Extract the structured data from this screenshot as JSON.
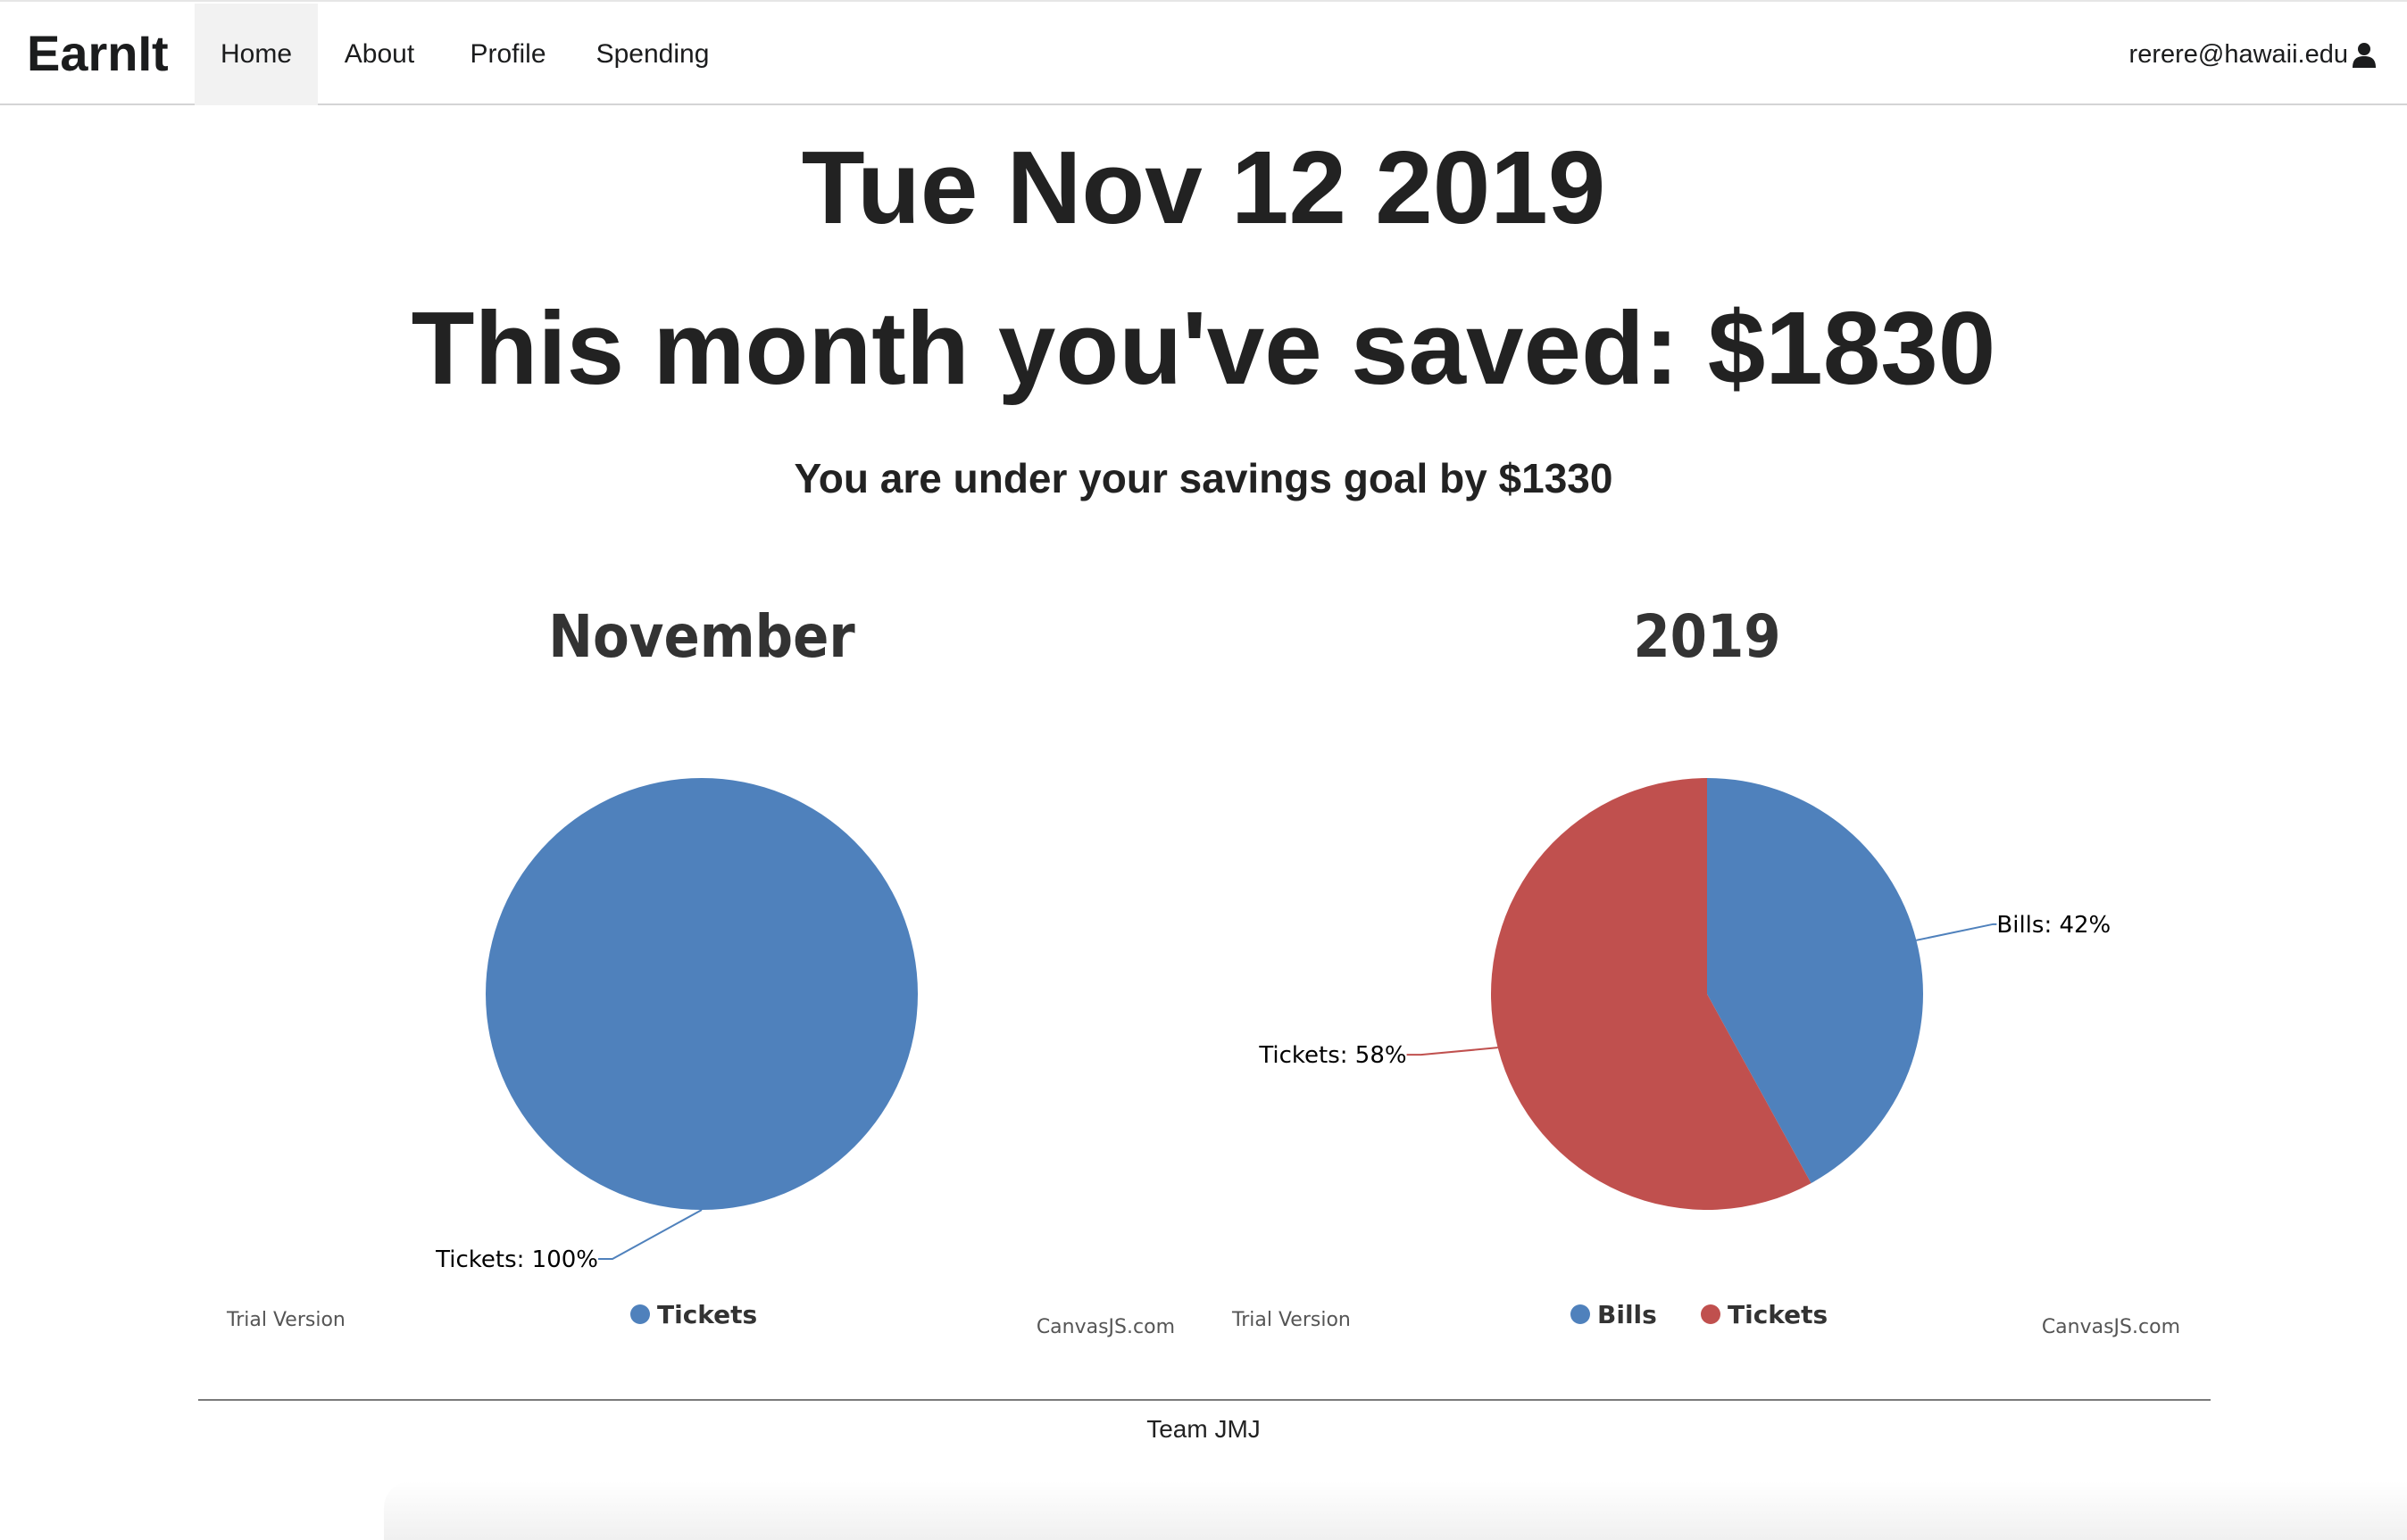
{
  "navbar": {
    "brand": "EarnIt",
    "items": [
      {
        "label": "Home",
        "active": true
      },
      {
        "label": "About",
        "active": false
      },
      {
        "label": "Profile",
        "active": false
      },
      {
        "label": "Spending",
        "active": false
      }
    ],
    "user_email": "rerere@hawaii.edu",
    "user_icon": "user-icon"
  },
  "main": {
    "date": "Tue Nov 12 2019",
    "saved": "This month you've saved: $1830",
    "goal": "You are under your savings goal by $1330"
  },
  "colors": {
    "blue": "#4f81bc",
    "red": "#c0504e"
  },
  "chart_data": [
    {
      "type": "pie",
      "title": "November",
      "slices": [
        {
          "label": "Tickets",
          "value": 100,
          "display": "Tickets: 100%",
          "color": "#4f81bc"
        }
      ],
      "legend": [
        "Tickets"
      ],
      "legend_placement": "bottom",
      "credits": {
        "left": "Trial Version",
        "right": "CanvasJS.com"
      }
    },
    {
      "type": "pie",
      "title": "2019",
      "slices": [
        {
          "label": "Bills",
          "value": 42,
          "display": "Bills: 42%",
          "color": "#4f81bc"
        },
        {
          "label": "Tickets",
          "value": 58,
          "display": "Tickets: 58%",
          "color": "#c0504e"
        }
      ],
      "legend": [
        "Bills",
        "Tickets"
      ],
      "legend_placement": "bottom",
      "credits": {
        "left": "Trial Version",
        "right": "CanvasJS.com"
      }
    }
  ],
  "footer": {
    "text": "Team JMJ"
  }
}
